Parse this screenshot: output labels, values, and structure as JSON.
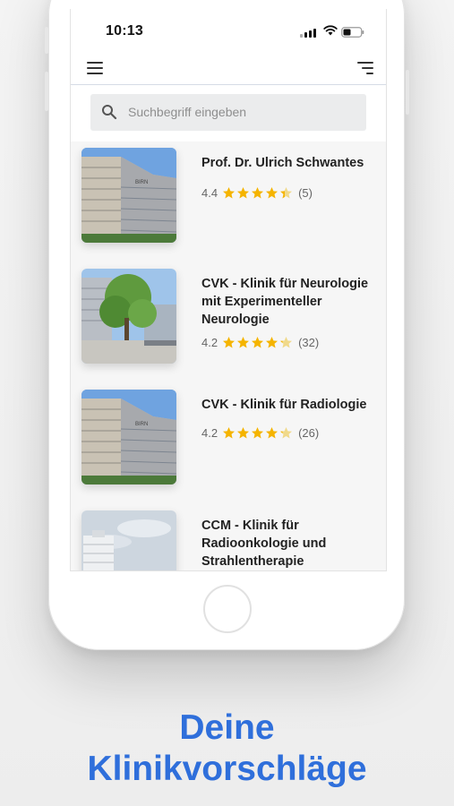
{
  "status_bar": {
    "time": "10:13"
  },
  "search": {
    "placeholder": "Suchbegriff eingeben"
  },
  "clinics": [
    {
      "name": "Prof. Dr. Ulrich Schwantes",
      "rating": "4.4",
      "rating_value": 4.4,
      "reviews": "(5)"
    },
    {
      "name": "CVK - Klinik für Neurologie mit Experimenteller Neurologie",
      "rating": "4.2",
      "rating_value": 4.2,
      "reviews": "(32)"
    },
    {
      "name": "CVK - Klinik für Radiologie",
      "rating": "4.2",
      "rating_value": 4.2,
      "reviews": "(26)"
    },
    {
      "name": "CCM - Klinik für Radioonkologie und Strahlentherapie"
    }
  ],
  "tagline": {
    "line1": "Deine",
    "line2": "Klinikvorschläge"
  },
  "colors": {
    "accent": "#2f6fdb",
    "star": "#f5b400",
    "star_empty": "#f0d98a"
  }
}
